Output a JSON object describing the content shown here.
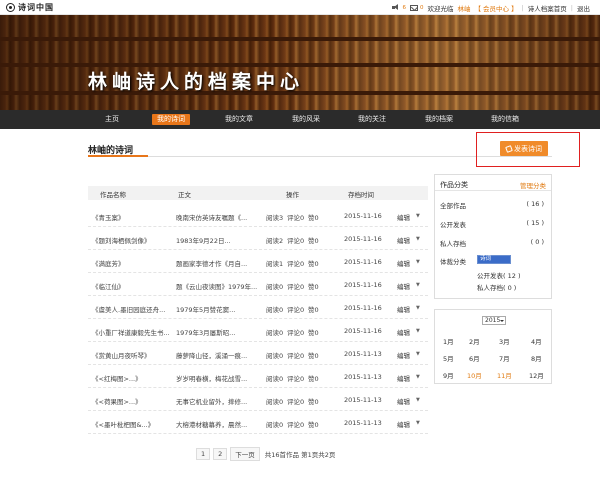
{
  "topbar": {
    "logo_text": "诗词中国",
    "msg_count": "6",
    "mail_count": "0",
    "welcome": "欢迎光临",
    "username": "林岫",
    "member_center": "【 会员中心 】",
    "separator": "|",
    "archive_home": "诗人档案首页",
    "logout": "退出"
  },
  "banner": {
    "title": "林岫诗人的档案中心"
  },
  "nav": {
    "items": [
      {
        "label": "主页"
      },
      {
        "label": "我的诗词"
      },
      {
        "label": "我的文章"
      },
      {
        "label": "我的风采"
      },
      {
        "label": "我的关注"
      },
      {
        "label": "我的档案"
      },
      {
        "label": "我的信箱"
      }
    ],
    "active_color": "#e8761a"
  },
  "section": {
    "title": "林岫的诗词",
    "publish_button": "发表诗词"
  },
  "table": {
    "headers": {
      "name": "作品名称",
      "body": "正文",
      "ops": "操作",
      "time": "存档时间"
    },
    "rows": [
      {
        "name": "《青玉案》",
        "body": "晚南宋仿英诗友嘱题《...",
        "read": "阅读3",
        "comment": "评论0",
        "like": "赞0",
        "time": "2015-11-16",
        "edit": "编辑"
      },
      {
        "name": "《题刘海栖佩剑像》",
        "body": "1983年9月22日...",
        "read": "阅读2",
        "comment": "评论0",
        "like": "赞0",
        "time": "2015-11-16",
        "edit": "编辑"
      },
      {
        "name": "《满庭芳》",
        "body": "题画家李德才作《月自...",
        "read": "阅读1",
        "comment": "评论0",
        "like": "赞0",
        "time": "2015-11-16",
        "edit": "编辑"
      },
      {
        "name": "《临江仙》",
        "body": "题《云山夜读图》1979年...",
        "read": "阅读0",
        "comment": "评论0",
        "like": "赞0",
        "time": "2015-11-16",
        "edit": "编辑"
      },
      {
        "name": "《虞美人.墨旧园庭还舟...",
        "body": "1979年5月赞花窦...",
        "read": "阅读0",
        "comment": "评论0",
        "like": "赞0",
        "time": "2015-11-16",
        "edit": "编辑"
      },
      {
        "name": "《小重厂祥道康毅先生书...",
        "body": "1979年3月屡斯昭...",
        "read": "阅读0",
        "comment": "评论0",
        "like": "赞0",
        "time": "2015-11-16",
        "edit": "编辑"
      },
      {
        "name": "《赏黄山月夜听琴》",
        "body": "藤萝降山径，溪涌一痕...",
        "read": "阅读0",
        "comment": "评论0",
        "like": "赞0",
        "time": "2015-11-13",
        "edit": "编辑"
      },
      {
        "name": "《<红梅图>...》",
        "body": "岁岁明春横，梅花战雪...",
        "read": "阅读0",
        "comment": "评论0",
        "like": "赞0",
        "time": "2015-11-13",
        "edit": "编辑"
      },
      {
        "name": "《<荷果图>...》",
        "body": "无事它机业留外，摔修...",
        "read": "阅读0",
        "comment": "评论0",
        "like": "赞0",
        "time": "2015-11-13",
        "edit": "编辑"
      },
      {
        "name": "《<墨叶枇杷图&...》",
        "body": "大榕港材糖幕养，晨然...",
        "read": "阅读0",
        "comment": "评论0",
        "like": "赞0",
        "time": "2015-11-13",
        "edit": "编辑"
      }
    ]
  },
  "pager": {
    "p1": "1",
    "p2": "2",
    "next": "下一页",
    "summary": "共16首作品 第1页共2页"
  },
  "categories": {
    "title": "作品分类",
    "manage": "管理分类",
    "items": [
      {
        "label": "全部作品",
        "value": "( 16 )"
      },
      {
        "label": "公开发表",
        "value": "( 15 )"
      },
      {
        "label": "私人存档",
        "value": "( 0 )"
      }
    ],
    "genre_label": "体裁分类",
    "genre_selected": "诗词",
    "sub": [
      {
        "text": "公开发表( 12 )"
      },
      {
        "text": "私人存档( 0 )"
      }
    ]
  },
  "calendar": {
    "year": "2015",
    "months": [
      "1月",
      "2月",
      "3月",
      "4月",
      "5月",
      "6月",
      "7月",
      "8月",
      "9月",
      "10月",
      "11月",
      "12月"
    ],
    "highlight_color": "#e07a10"
  }
}
